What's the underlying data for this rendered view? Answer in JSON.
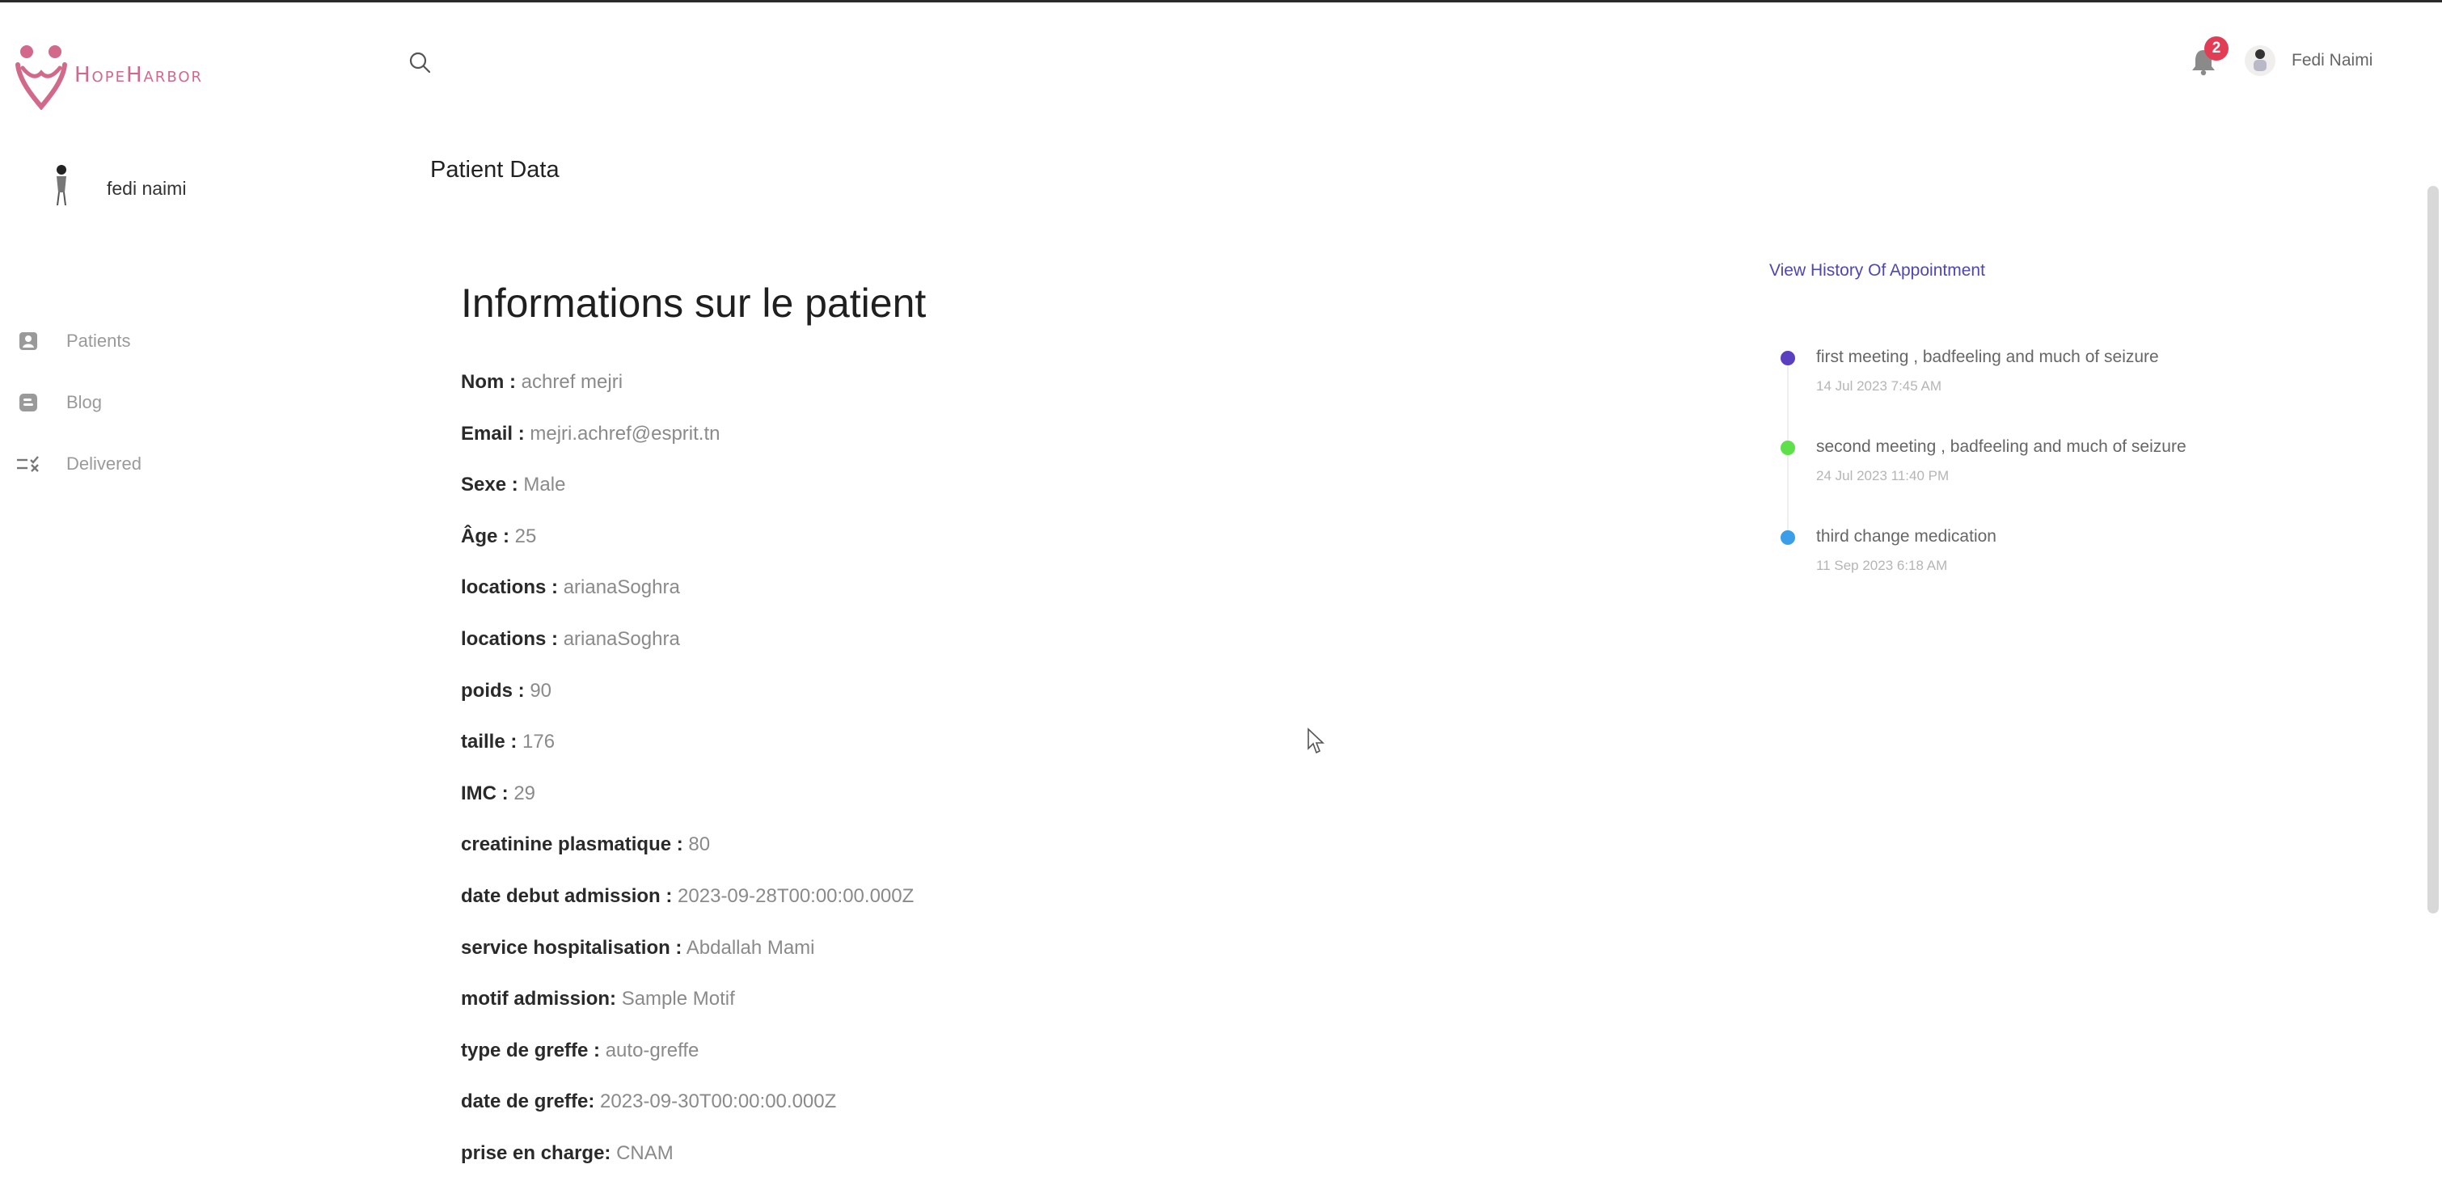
{
  "brand": {
    "name": "HopeHarbor",
    "color": "#d2698a"
  },
  "header": {
    "notifications_count": "2",
    "user_name": "Fedi Naimi"
  },
  "sidebar": {
    "profile_name": "fedi naimi",
    "items": [
      {
        "label": "Patients",
        "icon": "user-icon"
      },
      {
        "label": "Blog",
        "icon": "blog-icon"
      },
      {
        "label": "Delivered",
        "icon": "checklist-icon"
      }
    ]
  },
  "main": {
    "page_title": "Patient Data",
    "section_title": "Informations sur le patient",
    "fields": [
      {
        "label": "Nom :",
        "value": "achref mejri"
      },
      {
        "label": "Email :",
        "value": "mejri.achref@esprit.tn"
      },
      {
        "label": "Sexe :",
        "value": "Male"
      },
      {
        "label": "Âge :",
        "value": "25"
      },
      {
        "label": "locations :",
        "value": "arianaSoghra"
      },
      {
        "label": "locations :",
        "value": "arianaSoghra"
      },
      {
        "label": "poids :",
        "value": "90"
      },
      {
        "label": "taille :",
        "value": "176"
      },
      {
        "label": "IMC :",
        "value": "29"
      },
      {
        "label": "creatinine plasmatique :",
        "value": "80"
      },
      {
        "label": "date debut admission :",
        "value": "2023-09-28T00:00:00.000Z"
      },
      {
        "label": "service hospitalisation :",
        "value": "Abdallah Mami"
      },
      {
        "label": "motif admission:",
        "value": "Sample Motif"
      },
      {
        "label": "type de greffe :",
        "value": "auto-greffe"
      },
      {
        "label": "date de greffe:",
        "value": "2023-09-30T00:00:00.000Z"
      },
      {
        "label": "prise en charge:",
        "value": "CNAM"
      }
    ]
  },
  "history": {
    "link_label": "View History Of Appointment",
    "items": [
      {
        "title": "first meeting , badfeeling and much of seizure",
        "date": "14 Jul 2023 7:45 AM",
        "color": "#5a3fc0"
      },
      {
        "title": "second meeting , badfeeling and much of seizure",
        "date": "24 Jul 2023 11:40 PM",
        "color": "#5ee04a"
      },
      {
        "title": "third change medication",
        "date": "11 Sep 2023 6:18 AM",
        "color": "#3a9ee8"
      }
    ]
  },
  "colors": {
    "accent": "#4e46b4",
    "badge": "#e23d55"
  }
}
